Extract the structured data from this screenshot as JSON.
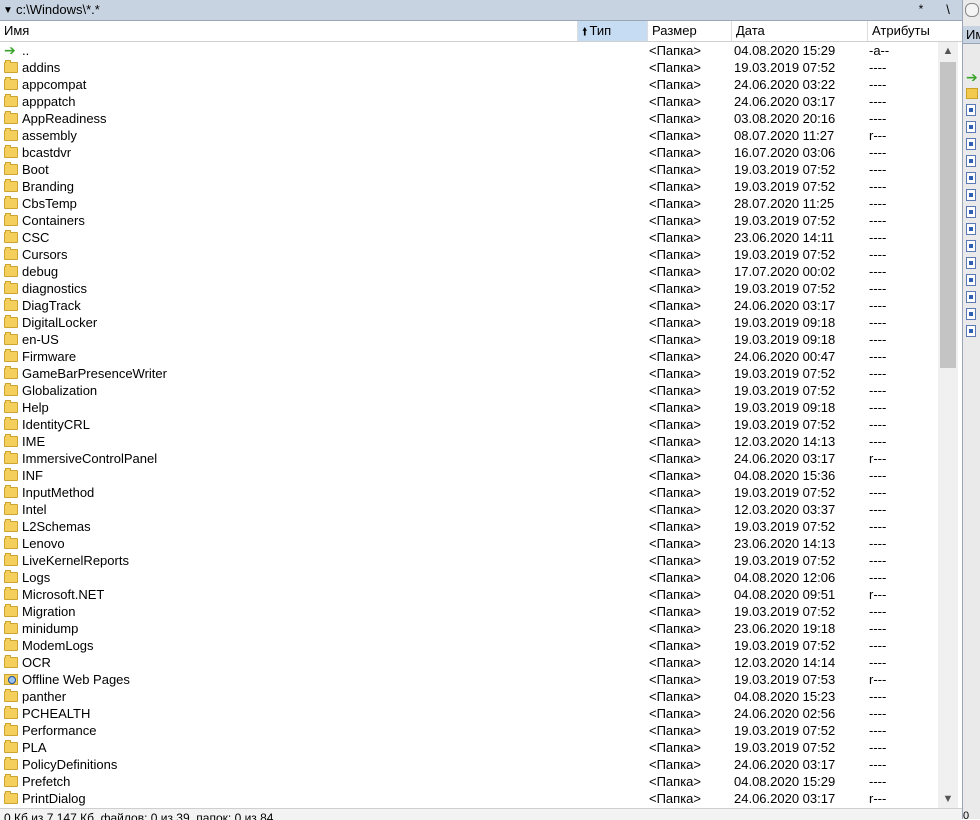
{
  "path_bar": {
    "arrow": "▼",
    "path": "c:\\Windows\\*.*",
    "star": "*",
    "up": "\\"
  },
  "columns": {
    "name": "Имя",
    "type": "Тип",
    "size": "Размер",
    "date": "Дата",
    "attributes": "Атрибуты",
    "sort_indicator": "🠙"
  },
  "rows": [
    {
      "icon": "up-arrow-icon",
      "name": "..",
      "size": "<Папка>",
      "date": "04.08.2020 15:29",
      "attr": "-a--"
    },
    {
      "icon": "folder-icon",
      "name": "addins",
      "size": "<Папка>",
      "date": "19.03.2019 07:52",
      "attr": "----"
    },
    {
      "icon": "folder-icon",
      "name": "appcompat",
      "size": "<Папка>",
      "date": "24.06.2020 03:22",
      "attr": "----"
    },
    {
      "icon": "folder-icon",
      "name": "apppatch",
      "size": "<Папка>",
      "date": "24.06.2020 03:17",
      "attr": "----"
    },
    {
      "icon": "folder-icon",
      "name": "AppReadiness",
      "size": "<Папка>",
      "date": "03.08.2020 20:16",
      "attr": "----"
    },
    {
      "icon": "folder-icon",
      "name": "assembly",
      "size": "<Папка>",
      "date": "08.07.2020 11:27",
      "attr": "r---"
    },
    {
      "icon": "folder-icon",
      "name": "bcastdvr",
      "size": "<Папка>",
      "date": "16.07.2020 03:06",
      "attr": "----"
    },
    {
      "icon": "folder-icon",
      "name": "Boot",
      "size": "<Папка>",
      "date": "19.03.2019 07:52",
      "attr": "----"
    },
    {
      "icon": "folder-icon",
      "name": "Branding",
      "size": "<Папка>",
      "date": "19.03.2019 07:52",
      "attr": "----"
    },
    {
      "icon": "folder-icon",
      "name": "CbsTemp",
      "size": "<Папка>",
      "date": "28.07.2020 11:25",
      "attr": "----"
    },
    {
      "icon": "folder-icon",
      "name": "Containers",
      "size": "<Папка>",
      "date": "19.03.2019 07:52",
      "attr": "----"
    },
    {
      "icon": "folder-icon",
      "name": "CSC",
      "size": "<Папка>",
      "date": "23.06.2020 14:11",
      "attr": "----"
    },
    {
      "icon": "folder-icon",
      "name": "Cursors",
      "size": "<Папка>",
      "date": "19.03.2019 07:52",
      "attr": "----"
    },
    {
      "icon": "folder-icon",
      "name": "debug",
      "size": "<Папка>",
      "date": "17.07.2020 00:02",
      "attr": "----"
    },
    {
      "icon": "folder-icon",
      "name": "diagnostics",
      "size": "<Папка>",
      "date": "19.03.2019 07:52",
      "attr": "----"
    },
    {
      "icon": "folder-icon",
      "name": "DiagTrack",
      "size": "<Папка>",
      "date": "24.06.2020 03:17",
      "attr": "----"
    },
    {
      "icon": "folder-icon",
      "name": "DigitalLocker",
      "size": "<Папка>",
      "date": "19.03.2019 09:18",
      "attr": "----"
    },
    {
      "icon": "folder-icon",
      "name": "en-US",
      "size": "<Папка>",
      "date": "19.03.2019 09:18",
      "attr": "----"
    },
    {
      "icon": "folder-icon",
      "name": "Firmware",
      "size": "<Папка>",
      "date": "24.06.2020 00:47",
      "attr": "----"
    },
    {
      "icon": "folder-icon",
      "name": "GameBarPresenceWriter",
      "size": "<Папка>",
      "date": "19.03.2019 07:52",
      "attr": "----"
    },
    {
      "icon": "folder-icon",
      "name": "Globalization",
      "size": "<Папка>",
      "date": "19.03.2019 07:52",
      "attr": "----"
    },
    {
      "icon": "folder-icon",
      "name": "Help",
      "size": "<Папка>",
      "date": "19.03.2019 09:18",
      "attr": "----"
    },
    {
      "icon": "folder-icon",
      "name": "IdentityCRL",
      "size": "<Папка>",
      "date": "19.03.2019 07:52",
      "attr": "----"
    },
    {
      "icon": "folder-icon",
      "name": "IME",
      "size": "<Папка>",
      "date": "12.03.2020 14:13",
      "attr": "----"
    },
    {
      "icon": "folder-icon",
      "name": "ImmersiveControlPanel",
      "size": "<Папка>",
      "date": "24.06.2020 03:17",
      "attr": "r---"
    },
    {
      "icon": "folder-icon",
      "name": "INF",
      "size": "<Папка>",
      "date": "04.08.2020 15:36",
      "attr": "----"
    },
    {
      "icon": "folder-icon",
      "name": "InputMethod",
      "size": "<Папка>",
      "date": "19.03.2019 07:52",
      "attr": "----"
    },
    {
      "icon": "folder-icon",
      "name": "Intel",
      "size": "<Папка>",
      "date": "12.03.2020 03:37",
      "attr": "----"
    },
    {
      "icon": "folder-icon",
      "name": "L2Schemas",
      "size": "<Папка>",
      "date": "19.03.2019 07:52",
      "attr": "----"
    },
    {
      "icon": "folder-icon",
      "name": "Lenovo",
      "size": "<Папка>",
      "date": "23.06.2020 14:13",
      "attr": "----"
    },
    {
      "icon": "folder-icon",
      "name": "LiveKernelReports",
      "size": "<Папка>",
      "date": "19.03.2019 07:52",
      "attr": "----"
    },
    {
      "icon": "folder-icon",
      "name": "Logs",
      "size": "<Папка>",
      "date": "04.08.2020 12:06",
      "attr": "----"
    },
    {
      "icon": "folder-icon",
      "name": "Microsoft.NET",
      "size": "<Папка>",
      "date": "04.08.2020 09:51",
      "attr": "r---"
    },
    {
      "icon": "folder-icon",
      "name": "Migration",
      "size": "<Папка>",
      "date": "19.03.2019 07:52",
      "attr": "----"
    },
    {
      "icon": "folder-icon",
      "name": "minidump",
      "size": "<Папка>",
      "date": "23.06.2020 19:18",
      "attr": "----"
    },
    {
      "icon": "folder-icon",
      "name": "ModemLogs",
      "size": "<Папка>",
      "date": "19.03.2019 07:52",
      "attr": "----"
    },
    {
      "icon": "folder-icon",
      "name": "OCR",
      "size": "<Папка>",
      "date": "12.03.2020 14:14",
      "attr": "----"
    },
    {
      "icon": "web-folder-icon",
      "name": "Offline Web Pages",
      "size": "<Папка>",
      "date": "19.03.2019 07:53",
      "attr": "r---"
    },
    {
      "icon": "folder-icon",
      "name": "panther",
      "size": "<Папка>",
      "date": "04.08.2020 15:23",
      "attr": "----"
    },
    {
      "icon": "folder-icon",
      "name": "PCHEALTH",
      "size": "<Папка>",
      "date": "24.06.2020 02:56",
      "attr": "----"
    },
    {
      "icon": "folder-icon",
      "name": "Performance",
      "size": "<Папка>",
      "date": "19.03.2019 07:52",
      "attr": "----"
    },
    {
      "icon": "folder-icon",
      "name": "PLA",
      "size": "<Папка>",
      "date": "19.03.2019 07:52",
      "attr": "----"
    },
    {
      "icon": "folder-icon",
      "name": "PolicyDefinitions",
      "size": "<Папка>",
      "date": "24.06.2020 03:17",
      "attr": "----"
    },
    {
      "icon": "folder-icon",
      "name": "Prefetch",
      "size": "<Папка>",
      "date": "04.08.2020 15:29",
      "attr": "----"
    },
    {
      "icon": "folder-icon",
      "name": "PrintDialog",
      "size": "<Папка>",
      "date": "24.06.2020 03:17",
      "attr": "r---"
    }
  ],
  "status": "0 Кб из 7 147 Кб, файлов: 0 из 39, папок: 0 из 84",
  "right_panel": {
    "header": "Им",
    "footer": "0"
  },
  "colors": {
    "path_bar": "#c8d3e2",
    "sorted_column": "#c5dcf3",
    "folder": "#f4cf5b"
  }
}
